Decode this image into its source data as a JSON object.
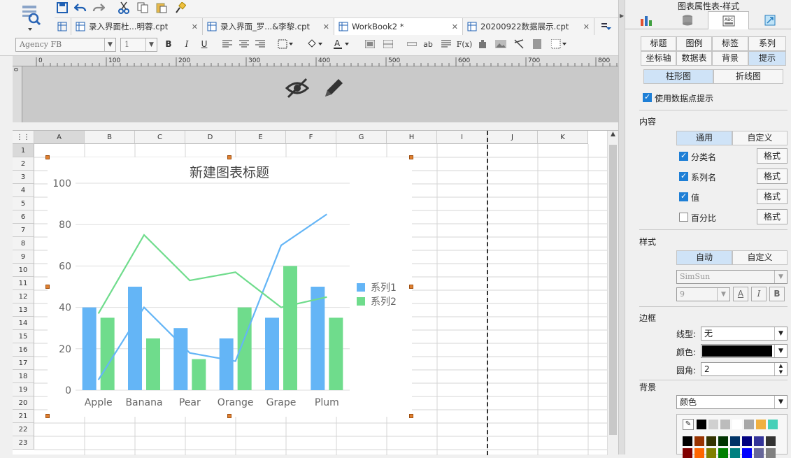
{
  "toolbar": {
    "tabs": [
      {
        "label": "录入界面杜...明蓉.cpt",
        "close": "✕"
      },
      {
        "label": "录入界面_罗...&李黎.cpt",
        "close": "✕"
      },
      {
        "label": "WorkBook2 *",
        "close": "✕"
      },
      {
        "label": "20200922数据展示.cpt",
        "close": "✕"
      }
    ],
    "font_family": "Agency FB",
    "font_size": "1"
  },
  "ruler": {
    "ticks": [
      "0",
      "100",
      "200",
      "300",
      "400",
      "500",
      "600",
      "700",
      "800"
    ]
  },
  "sheet": {
    "columns": [
      "A",
      "B",
      "C",
      "D",
      "E",
      "F",
      "G",
      "H",
      "I",
      "J",
      "K"
    ],
    "rows": [
      "1",
      "2",
      "3",
      "4",
      "5",
      "6",
      "7",
      "8",
      "9",
      "10",
      "11",
      "12",
      "13",
      "14",
      "15",
      "16",
      "17",
      "18",
      "19",
      "20",
      "21",
      "22",
      "23"
    ]
  },
  "chart_data": {
    "type": "bar+line",
    "title": "新建图表标题",
    "categories": [
      "Apple",
      "Banana",
      "Pear",
      "Orange",
      "Grape",
      "Plum"
    ],
    "ylim": [
      0,
      100
    ],
    "yticks": [
      0,
      20,
      40,
      60,
      80,
      100
    ],
    "series": [
      {
        "name": "系列1",
        "bars": [
          40,
          50,
          30,
          25,
          35,
          50
        ],
        "line": [
          5,
          40,
          18,
          14,
          70,
          85
        ],
        "color": "#64b5f6"
      },
      {
        "name": "系列2",
        "bars": [
          35,
          25,
          15,
          40,
          60,
          35
        ],
        "line": [
          37,
          75,
          53,
          57,
          40,
          45
        ],
        "color": "#6fdc8c"
      }
    ],
    "legend": "right",
    "grid": true
  },
  "panel": {
    "title": "图表属性表-样式",
    "row1": [
      "标题",
      "图例",
      "标签",
      "系列"
    ],
    "row2": [
      "坐标轴",
      "数据表",
      "背景",
      "提示"
    ],
    "type_tabs": [
      "柱形图",
      "折线图"
    ],
    "use_datapoint_tip": "使用数据点提示",
    "content_label": "内容",
    "content_tabs": [
      "通用",
      "自定义"
    ],
    "content_items": [
      {
        "label": "分类名",
        "checked": true,
        "btn": "格式"
      },
      {
        "label": "系列名",
        "checked": true,
        "btn": "格式"
      },
      {
        "label": "值",
        "checked": true,
        "btn": "格式"
      },
      {
        "label": "百分比",
        "checked": false,
        "btn": "格式"
      }
    ],
    "style_label": "样式",
    "style_tabs": [
      "自动",
      "自定义"
    ],
    "font_name": "SimSun",
    "font_size": "9",
    "border_label": "边框",
    "line_type_label": "线型:",
    "line_type_value": "无",
    "color_label": "颜色:",
    "color_value": "#000000",
    "radius_label": "圆角:",
    "radius_value": "2",
    "bg_label": "背景",
    "bg_value": "颜色",
    "swatches_row1": [
      "#000000",
      "#d0d0d0",
      "#bcbcbc",
      "#ffffff",
      "#a8a8a8",
      "#f0b040",
      "#46d0b8"
    ],
    "swatches_row2": [
      "#000000",
      "#993300",
      "#333300",
      "#003300",
      "#003366",
      "#000080",
      "#333399",
      "#333333"
    ],
    "swatches_row3": [
      "#800000",
      "#ff6600",
      "#808000",
      "#008000",
      "#008080",
      "#0000ff",
      "#666699",
      "#808080"
    ]
  }
}
